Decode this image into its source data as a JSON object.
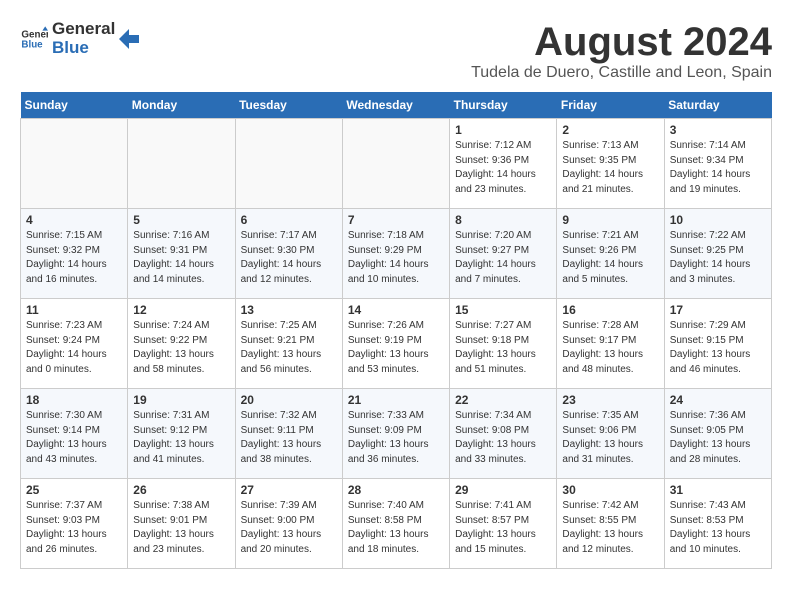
{
  "header": {
    "logo_general": "General",
    "logo_blue": "Blue",
    "title": "August 2024",
    "subtitle": "Tudela de Duero, Castille and Leon, Spain"
  },
  "weekdays": [
    "Sunday",
    "Monday",
    "Tuesday",
    "Wednesday",
    "Thursday",
    "Friday",
    "Saturday"
  ],
  "weeks": [
    [
      {
        "day": "",
        "empty": true
      },
      {
        "day": "",
        "empty": true
      },
      {
        "day": "",
        "empty": true
      },
      {
        "day": "",
        "empty": true
      },
      {
        "day": "1",
        "sunrise": "7:12 AM",
        "sunset": "9:36 PM",
        "daylight": "14 hours and 23 minutes."
      },
      {
        "day": "2",
        "sunrise": "7:13 AM",
        "sunset": "9:35 PM",
        "daylight": "14 hours and 21 minutes."
      },
      {
        "day": "3",
        "sunrise": "7:14 AM",
        "sunset": "9:34 PM",
        "daylight": "14 hours and 19 minutes."
      }
    ],
    [
      {
        "day": "4",
        "sunrise": "7:15 AM",
        "sunset": "9:32 PM",
        "daylight": "14 hours and 16 minutes."
      },
      {
        "day": "5",
        "sunrise": "7:16 AM",
        "sunset": "9:31 PM",
        "daylight": "14 hours and 14 minutes."
      },
      {
        "day": "6",
        "sunrise": "7:17 AM",
        "sunset": "9:30 PM",
        "daylight": "14 hours and 12 minutes."
      },
      {
        "day": "7",
        "sunrise": "7:18 AM",
        "sunset": "9:29 PM",
        "daylight": "14 hours and 10 minutes."
      },
      {
        "day": "8",
        "sunrise": "7:20 AM",
        "sunset": "9:27 PM",
        "daylight": "14 hours and 7 minutes."
      },
      {
        "day": "9",
        "sunrise": "7:21 AM",
        "sunset": "9:26 PM",
        "daylight": "14 hours and 5 minutes."
      },
      {
        "day": "10",
        "sunrise": "7:22 AM",
        "sunset": "9:25 PM",
        "daylight": "14 hours and 3 minutes."
      }
    ],
    [
      {
        "day": "11",
        "sunrise": "7:23 AM",
        "sunset": "9:24 PM",
        "daylight": "14 hours and 0 minutes."
      },
      {
        "day": "12",
        "sunrise": "7:24 AM",
        "sunset": "9:22 PM",
        "daylight": "13 hours and 58 minutes."
      },
      {
        "day": "13",
        "sunrise": "7:25 AM",
        "sunset": "9:21 PM",
        "daylight": "13 hours and 56 minutes."
      },
      {
        "day": "14",
        "sunrise": "7:26 AM",
        "sunset": "9:19 PM",
        "daylight": "13 hours and 53 minutes."
      },
      {
        "day": "15",
        "sunrise": "7:27 AM",
        "sunset": "9:18 PM",
        "daylight": "13 hours and 51 minutes."
      },
      {
        "day": "16",
        "sunrise": "7:28 AM",
        "sunset": "9:17 PM",
        "daylight": "13 hours and 48 minutes."
      },
      {
        "day": "17",
        "sunrise": "7:29 AM",
        "sunset": "9:15 PM",
        "daylight": "13 hours and 46 minutes."
      }
    ],
    [
      {
        "day": "18",
        "sunrise": "7:30 AM",
        "sunset": "9:14 PM",
        "daylight": "13 hours and 43 minutes."
      },
      {
        "day": "19",
        "sunrise": "7:31 AM",
        "sunset": "9:12 PM",
        "daylight": "13 hours and 41 minutes."
      },
      {
        "day": "20",
        "sunrise": "7:32 AM",
        "sunset": "9:11 PM",
        "daylight": "13 hours and 38 minutes."
      },
      {
        "day": "21",
        "sunrise": "7:33 AM",
        "sunset": "9:09 PM",
        "daylight": "13 hours and 36 minutes."
      },
      {
        "day": "22",
        "sunrise": "7:34 AM",
        "sunset": "9:08 PM",
        "daylight": "13 hours and 33 minutes."
      },
      {
        "day": "23",
        "sunrise": "7:35 AM",
        "sunset": "9:06 PM",
        "daylight": "13 hours and 31 minutes."
      },
      {
        "day": "24",
        "sunrise": "7:36 AM",
        "sunset": "9:05 PM",
        "daylight": "13 hours and 28 minutes."
      }
    ],
    [
      {
        "day": "25",
        "sunrise": "7:37 AM",
        "sunset": "9:03 PM",
        "daylight": "13 hours and 26 minutes."
      },
      {
        "day": "26",
        "sunrise": "7:38 AM",
        "sunset": "9:01 PM",
        "daylight": "13 hours and 23 minutes."
      },
      {
        "day": "27",
        "sunrise": "7:39 AM",
        "sunset": "9:00 PM",
        "daylight": "13 hours and 20 minutes."
      },
      {
        "day": "28",
        "sunrise": "7:40 AM",
        "sunset": "8:58 PM",
        "daylight": "13 hours and 18 minutes."
      },
      {
        "day": "29",
        "sunrise": "7:41 AM",
        "sunset": "8:57 PM",
        "daylight": "13 hours and 15 minutes."
      },
      {
        "day": "30",
        "sunrise": "7:42 AM",
        "sunset": "8:55 PM",
        "daylight": "13 hours and 12 minutes."
      },
      {
        "day": "31",
        "sunrise": "7:43 AM",
        "sunset": "8:53 PM",
        "daylight": "13 hours and 10 minutes."
      }
    ]
  ]
}
